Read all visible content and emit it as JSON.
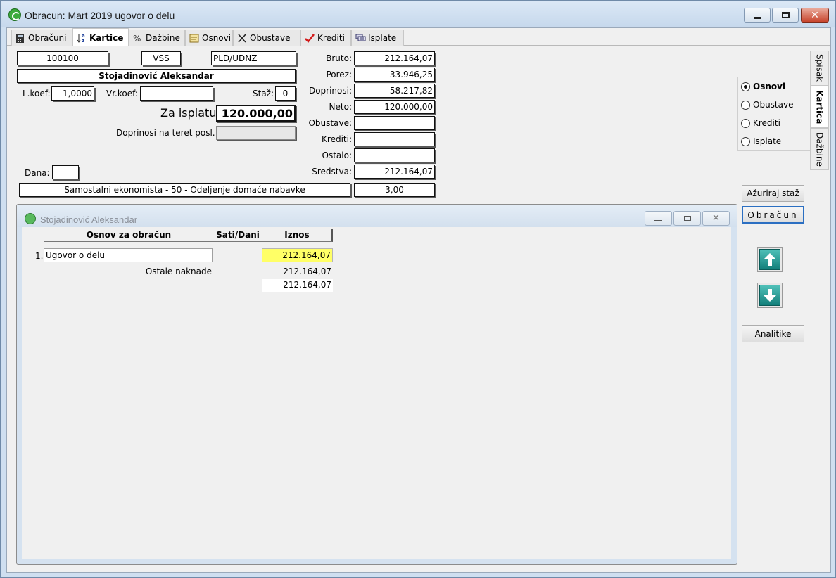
{
  "window": {
    "title": "Obracun: Mart 2019 ugovor o delu",
    "minimize_icon": "minimize-icon",
    "maximize_icon": "maximize-icon",
    "close_icon": "close-icon"
  },
  "tabs": [
    {
      "label": "Obračuni",
      "icon": "calculator-icon"
    },
    {
      "label": "Kartice",
      "icon": "sort-az-icon",
      "active": true
    },
    {
      "label": "Dažbine",
      "icon": "percent-icon"
    },
    {
      "label": "Osnovi",
      "icon": "document-icon"
    },
    {
      "label": "Obustave",
      "icon": "x-icon"
    },
    {
      "label": "Krediti",
      "icon": "checkmark-icon"
    },
    {
      "label": "Isplate",
      "icon": "list-icon"
    }
  ],
  "employee": {
    "code": "100100",
    "qualification": "VSS",
    "category": "PLD/UDNZ",
    "name": "Stojadinović Aleksandar",
    "lkoef_label": "L.koef:",
    "lkoef_value": "1,0000",
    "vrkoef_label": "Vr.koef:",
    "vrkoef_value": "",
    "staz_label": "Staž:",
    "staz_value": "0",
    "za_isplatu_label": "Za isplatu:",
    "za_isplatu_value": "120.000,00",
    "doprinosi_poslodavac_label": "Doprinosi na teret posl.:",
    "doprinosi_poslodavac_value": "",
    "dana_label": "Dana:",
    "dana_value": "",
    "department": "Samostalni ekonomista - 50 - Odeljenje domaće nabavke",
    "department_value": "3,00"
  },
  "totals": [
    {
      "label": "Bruto:",
      "value": "212.164,07"
    },
    {
      "label": "Porez:",
      "value": "33.946,25"
    },
    {
      "label": "Doprinosi:",
      "value": "58.217,82"
    },
    {
      "label": "Neto:",
      "value": "120.000,00"
    },
    {
      "label": "Obustave:",
      "value": ""
    },
    {
      "label": "Krediti:",
      "value": ""
    },
    {
      "label": "Ostalo:",
      "value": ""
    },
    {
      "label": "Sredstva:",
      "value": "212.164,07"
    }
  ],
  "radio_options": [
    {
      "label": "Osnovi",
      "checked": true
    },
    {
      "label": "Obustave",
      "checked": false
    },
    {
      "label": "Krediti",
      "checked": false
    },
    {
      "label": "Isplate",
      "checked": false
    }
  ],
  "vertical_tabs": [
    "Spisak",
    "Kartica",
    "Dažbine"
  ],
  "buttons": {
    "azuriraj_staz": "Ažuriraj staž",
    "obracun": "Obračun",
    "analitike": "Analitike"
  },
  "child_window": {
    "title": "Stojadinović Aleksandar",
    "columns": [
      "Osnov za obračun",
      "Sati/Dani",
      "Iznos"
    ],
    "rows": [
      {
        "num": "1.",
        "name": "Ugovor o delu",
        "hours": "",
        "amount": "212.164,07"
      }
    ],
    "other_label": "Ostale naknade",
    "other_value": "212.164,07",
    "total_value": "212.164,07"
  },
  "colors": {
    "highlight": "#ffff66",
    "accent": "#2b6fc2",
    "arrow": "#1a8f88"
  }
}
